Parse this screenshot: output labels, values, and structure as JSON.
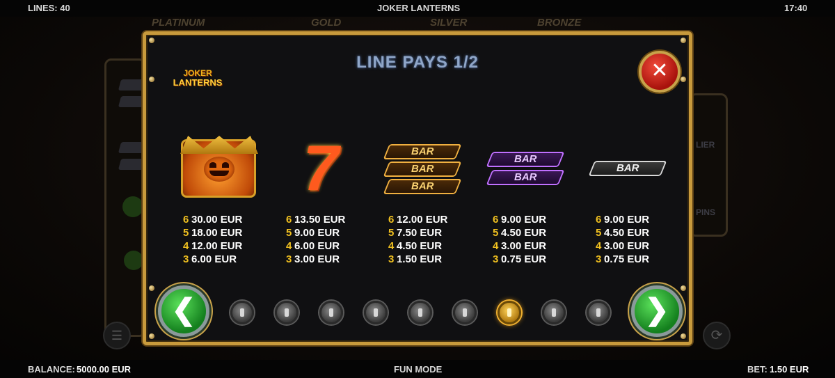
{
  "top_bar": {
    "lines": "LINES: 40",
    "title": "JOKER LANTERNS",
    "time": "17:40"
  },
  "background": {
    "tabs": [
      "PLATINUM",
      "GOLD",
      "SILVER",
      "BRONZE"
    ],
    "side_labels": [
      "LIER",
      "PINS"
    ]
  },
  "paytable": {
    "title": "LINE PAYS 1/2",
    "logo": {
      "line1": "JOKER",
      "line2": "LANTERNS"
    },
    "close_icon": "close-icon",
    "symbols": [
      {
        "name": "joker-pumpkin-icon",
        "pays": [
          {
            "n": "6",
            "v": "30.00 EUR"
          },
          {
            "n": "5",
            "v": "18.00 EUR"
          },
          {
            "n": "4",
            "v": "12.00 EUR"
          },
          {
            "n": "3",
            "v": "6.00 EUR"
          }
        ]
      },
      {
        "name": "seven-icon",
        "glyph": "7",
        "pays": [
          {
            "n": "6",
            "v": "13.50 EUR"
          },
          {
            "n": "5",
            "v": "9.00 EUR"
          },
          {
            "n": "4",
            "v": "6.00 EUR"
          },
          {
            "n": "3",
            "v": "3.00 EUR"
          }
        ]
      },
      {
        "name": "triple-bar-icon",
        "label": "BAR",
        "pays": [
          {
            "n": "6",
            "v": "12.00 EUR"
          },
          {
            "n": "5",
            "v": "7.50 EUR"
          },
          {
            "n": "4",
            "v": "4.50 EUR"
          },
          {
            "n": "3",
            "v": "1.50 EUR"
          }
        ]
      },
      {
        "name": "double-bar-icon",
        "label": "BAR",
        "pays": [
          {
            "n": "6",
            "v": "9.00 EUR"
          },
          {
            "n": "5",
            "v": "4.50 EUR"
          },
          {
            "n": "4",
            "v": "3.00 EUR"
          },
          {
            "n": "3",
            "v": "0.75 EUR"
          }
        ]
      },
      {
        "name": "single-bar-icon",
        "label": "BAR",
        "pays": [
          {
            "n": "6",
            "v": "9.00 EUR"
          },
          {
            "n": "5",
            "v": "4.50 EUR"
          },
          {
            "n": "4",
            "v": "3.00 EUR"
          },
          {
            "n": "3",
            "v": "0.75 EUR"
          }
        ]
      }
    ],
    "navigation": {
      "prev_icon": "arrow-left-icon",
      "prev_glyph": "❮",
      "next_icon": "arrow-right-icon",
      "next_glyph": "❯",
      "page_count": 9,
      "active_page": 7
    }
  },
  "bottom_bar": {
    "balance_label": "BALANCE:",
    "balance_value": "5000.00 EUR",
    "mode": "FUN MODE",
    "bet_label": "BET:",
    "bet_value": "1.50 EUR"
  },
  "colors": {
    "frame": "#c89a3c",
    "panel": "#101012",
    "pay_number": "#f0c020",
    "close": "#c8221a",
    "nav": "#1e9a28"
  }
}
